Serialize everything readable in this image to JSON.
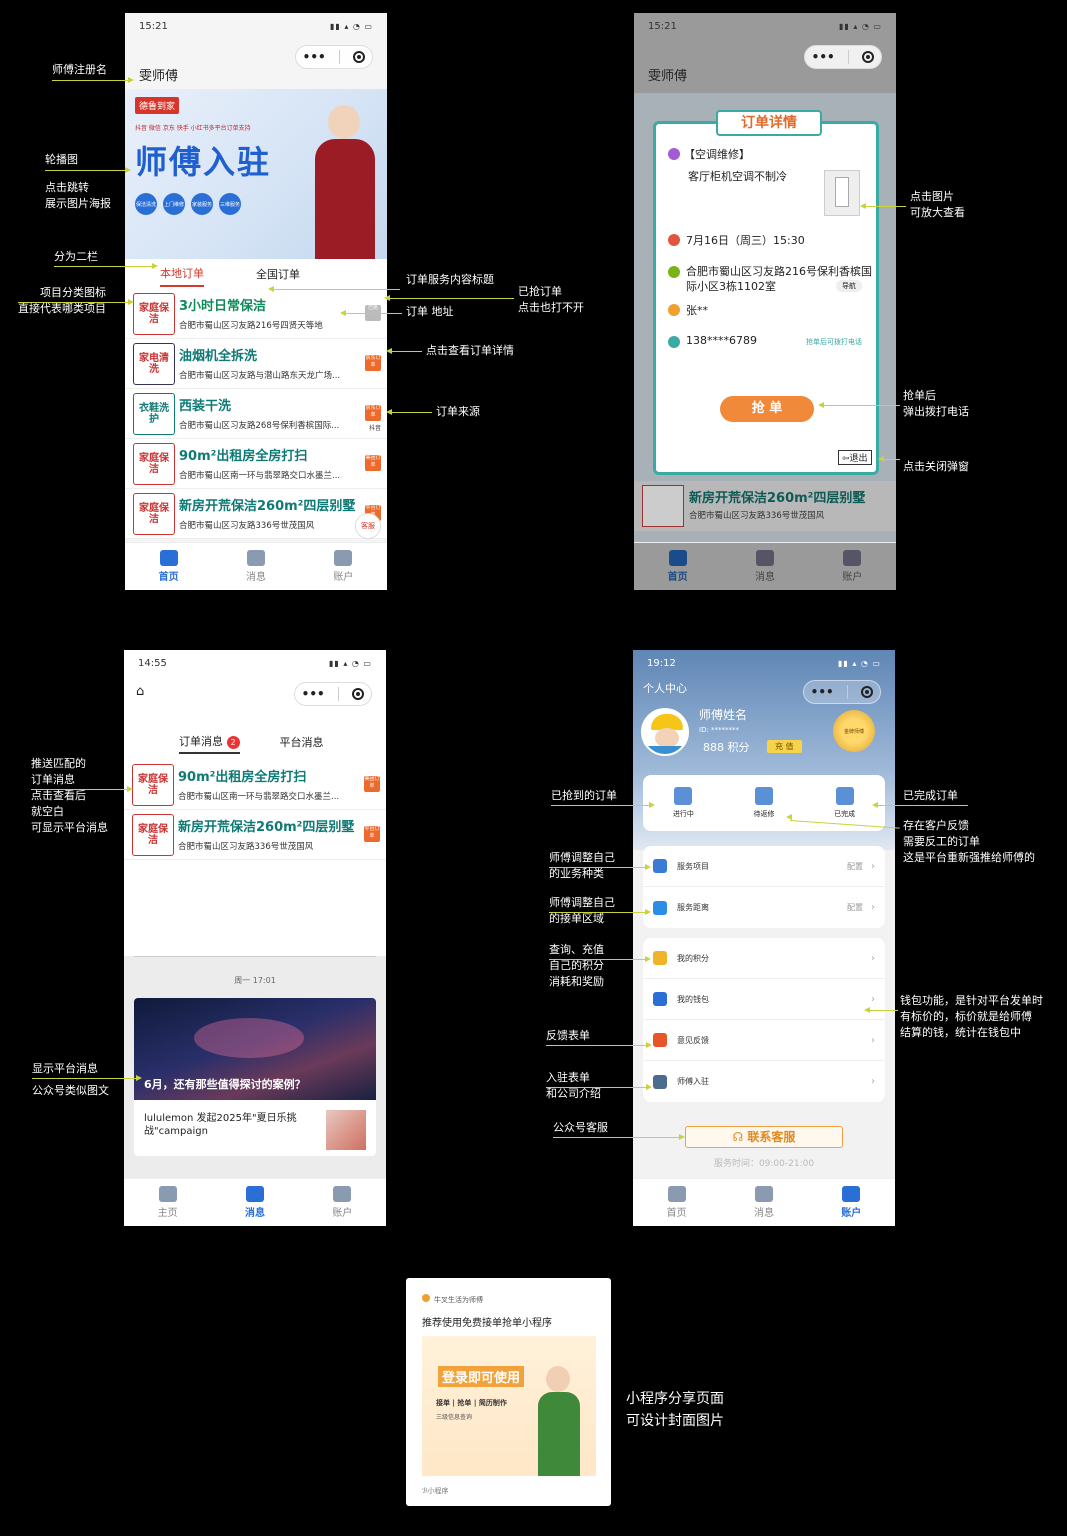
{
  "screen1": {
    "time": "15:21",
    "title": "雯师傅",
    "banner": {
      "logo": "德鲁到家",
      "platforms": "抖音 微信 京东 快手 小红书多平台订单支持",
      "headline": "师傅入驻",
      "badges": [
        "保洁清洗",
        "上门维修",
        "家装服务",
        "三维服务"
      ]
    },
    "tabs": [
      "本地订单",
      "全国订单"
    ],
    "orders": [
      {
        "thumb": "家庭保洁",
        "title": "3小时日常保洁",
        "addr": "合肥市蜀山区习友路216号四贤天等地",
        "badge": "已抢",
        "grey": true
      },
      {
        "thumb": "家电清洗",
        "title": "油烟机全拆洗",
        "addr": "合肥市蜀山区习友路与潜山路东天龙广场...",
        "badge": "京东订单"
      },
      {
        "thumb": "衣鞋洗护",
        "title": "西装干洗",
        "addr": "合肥市蜀山区习友路268号保利香槟国际...",
        "badge": "京东订单",
        "src": "抖音"
      },
      {
        "thumb": "家庭保洁",
        "title": "90m²出租房全房打扫",
        "addr": "合肥市蜀山区南一环与翡翠路交口水墨兰...",
        "badge": "美团订单"
      },
      {
        "thumb": "家庭保洁",
        "title": "新房开荒保洁260m²四层别墅",
        "addr": "合肥市蜀山区习友路336号世茂国风",
        "badge": "平台订单"
      }
    ],
    "service": "客服",
    "tabbar": [
      "首页",
      "消息",
      "账户"
    ]
  },
  "screen2": {
    "time": "15:21",
    "title": "雯师傅",
    "modal": {
      "title": "订单详情",
      "category": "【空调维修】",
      "desc": "客厅柜机空调不制冷",
      "datetime": "7月16日（周三）15:30",
      "address": "合肥市蜀山区习友路216号保利香槟国际小区3栋1102室",
      "nav": "导航",
      "name": "张**",
      "phone": "138****6789",
      "phone_note": "抢单后可拨打电话",
      "grab": "抢 单",
      "exit": "退出"
    },
    "bottom_title": "新房开荒保洁260m²四层别墅",
    "bottom_addr": "合肥市蜀山区习友路336号世茂国风",
    "tabbar": [
      "首页",
      "消息",
      "账户"
    ]
  },
  "screen3": {
    "time": "14:55",
    "tabs": [
      "订单消息",
      "平台消息"
    ],
    "unread": "2",
    "orders": [
      {
        "thumb": "家庭保洁",
        "title": "90m²出租房全房打扫",
        "addr": "合肥市蜀山区南一环与翡翠路交口水墨兰...",
        "badge": "美团订单"
      },
      {
        "thumb": "家庭保洁",
        "title": "新房开荒保洁260m²四层别墅",
        "addr": "合肥市蜀山区习友路336号世茂国风",
        "badge": "平台订单"
      }
    ],
    "msg_time": "周一 17:01",
    "article_title": "6月，还有那些值得探讨的案例？",
    "article_sub": "lululemon 发起2025年\"夏日乐挑战\"campaign",
    "tabbar": [
      "主页",
      "消息",
      "账户"
    ]
  },
  "screen4": {
    "time": "19:12",
    "header": "个人中心",
    "name": "师傅姓名",
    "id": "ID: ********",
    "points": "888 积分",
    "recharge": "充 值",
    "medal": "金牌师傅",
    "status": [
      "进行中",
      "待返修",
      "已完成"
    ],
    "menu1": [
      {
        "label": "服务项目",
        "value": "配置",
        "color": "#3a7bd5"
      },
      {
        "label": "服务距离",
        "value": "配置",
        "color": "#2a8ee6"
      }
    ],
    "menu2": [
      {
        "label": "我的积分",
        "color": "#f0b429"
      },
      {
        "label": "我的钱包",
        "color": "#2a6fd6"
      },
      {
        "label": "意见反馈",
        "color": "#e8552b"
      },
      {
        "label": "师傅入驻",
        "color": "#4b6c8f"
      }
    ],
    "contact": "联系客服",
    "hours": "服务时间：09:00-21:00",
    "tabbar": [
      "首页",
      "消息",
      "账户"
    ]
  },
  "share": {
    "source": "牛叉生活为师傅",
    "title": "推荐使用免费接单抢单小程序",
    "banner": "登录即可使用",
    "features": "接单 | 抢单 | 简历制作",
    "sub": "三级信息查询",
    "footer": "小程序"
  },
  "annotations": {
    "a1": "师傅注册名",
    "a2": "轮播图",
    "a3": "点击跳转\n展示图片海报",
    "a4": "分为二栏",
    "a5": "项目分类图标\n直接代表哪类项目",
    "a6": "订单服务内容标题",
    "a7": "已抢订单\n点击也打不开",
    "a8": "订单 地址",
    "a9": "点击查看订单详情",
    "a10": "订单来源",
    "a11": "点击图片\n可放大查看",
    "a12": "抢单后\n弹出拨打电话",
    "a13": "点击关闭弹窗",
    "a14": "推送匹配的\n订单消息\n点击查看后\n就空白\n可显示平台消息",
    "a15": "显示平台消息\n公众号类似图文",
    "a16": "已抢到的订单",
    "a17": "已完成订单",
    "a18": "存在客户反馈\n需要反工的订单\n这是平台重新强推给师傅的",
    "a19": "师傅调整自己\n的业务种类",
    "a20": "师傅调整自己\n的接单区域",
    "a21": "查询、充值\n自己的积分\n消耗和奖励",
    "a22": "钱包功能，是针对平台发单时\n有标价的，标价就是给师傅\n结算的钱，统计在钱包中",
    "a23": "反馈表单",
    "a24": "入驻表单\n和公司介绍",
    "a25": "公众号客服",
    "a26": "小程序分享页面\n可设计封面图片"
  }
}
